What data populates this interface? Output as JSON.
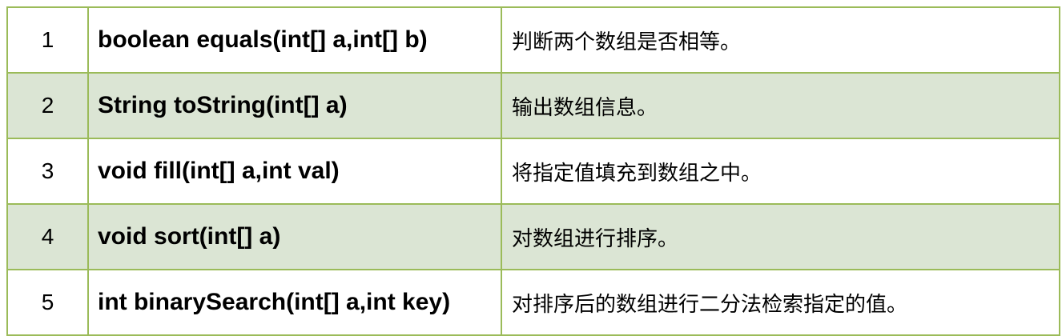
{
  "table": {
    "rows": [
      {
        "num": "1",
        "method": "boolean equals(int[] a,int[] b)",
        "desc": "判断两个数组是否相等。"
      },
      {
        "num": "2",
        "method": "String toString(int[] a)",
        "desc": "输出数组信息。"
      },
      {
        "num": "3",
        "method": "void fill(int[] a,int val)",
        "desc": "将指定值填充到数组之中。"
      },
      {
        "num": "4",
        "method": "void sort(int[] a)",
        "desc": "对数组进行排序。"
      },
      {
        "num": "5",
        "method": "int binarySearch(int[] a,int key)",
        "desc": "对排序后的数组进行二分法检索指定的值。"
      }
    ]
  },
  "colors": {
    "border": "#9bbb59",
    "stripe": "#dbe5d4",
    "background": "#ffffff"
  }
}
